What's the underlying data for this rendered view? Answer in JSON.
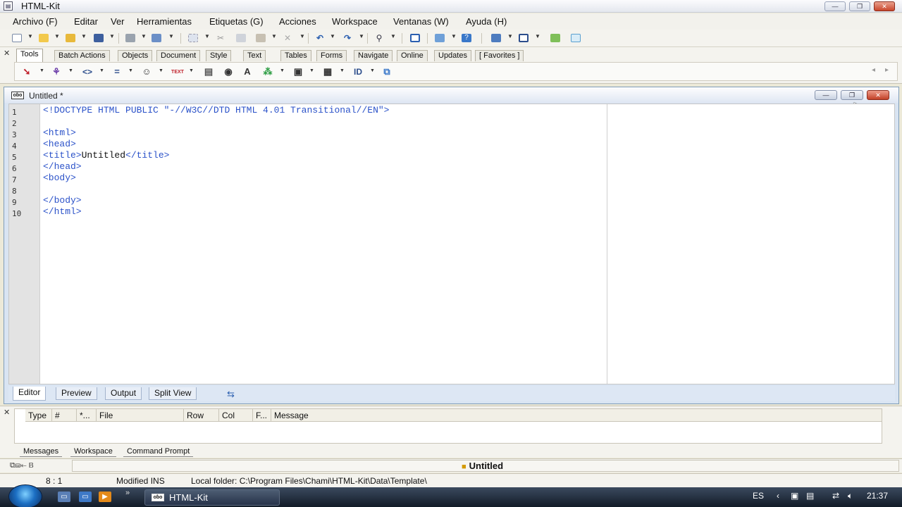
{
  "window": {
    "title": "HTML-Kit",
    "min_label": "—",
    "max_label": "❐",
    "close_label": "✕"
  },
  "menu": [
    "Archivo (F)",
    "Editar",
    "Ver",
    "Herramientas",
    "Etiquetas (G)",
    "Acciones",
    "Workspace",
    "Ventanas (W)",
    "Ayuda (H)"
  ],
  "tool_tabs": [
    "Tools",
    "Batch Actions",
    "Objects",
    "Document",
    "Style",
    "Text",
    "Tables",
    "Forms",
    "Navigate",
    "Online",
    "Updates",
    "[ Favorites ]"
  ],
  "tools_row": {
    "id_label": "ID",
    "text_label": "TEXT"
  },
  "document": {
    "title": "Untitled *",
    "icon_text": "oɓo",
    "lines": [
      {
        "n": "1",
        "code": "<!DOCTYPE HTML PUBLIC \"-//W3C//DTD HTML 4.01 Transitional//EN\">"
      },
      {
        "n": "2",
        "code": ""
      },
      {
        "n": "3",
        "code": "<html>"
      },
      {
        "n": "4",
        "code": "<head>"
      },
      {
        "n": "5",
        "code": "<title>Untitled</title>"
      },
      {
        "n": "6",
        "code": "</head>"
      },
      {
        "n": "7",
        "code": "<body>"
      },
      {
        "n": "8",
        "code": ""
      },
      {
        "n": "9",
        "code": "</body>"
      },
      {
        "n": "10",
        "code": "</html>"
      }
    ],
    "view_tabs": [
      "Editor",
      "Preview",
      "Output",
      "Split View"
    ]
  },
  "messages": {
    "columns": [
      "Type",
      "#",
      "*...",
      "File",
      "Row",
      "Col",
      "F...",
      "Message"
    ],
    "tabs": [
      "Messages",
      "Workspace",
      "Command Prompt"
    ]
  },
  "file_bar": {
    "name": "Untitled"
  },
  "status": {
    "position": "8 : 1",
    "mode": "Modified INS",
    "folder": "Local folder: C:\\Program Files\\Chami\\HTML-Kit\\Data\\Template\\"
  },
  "taskbar": {
    "task_label": "HTML-Kit",
    "lang": "ES",
    "clock": "21:37"
  },
  "colors": {
    "code_tag": "#2b52c9",
    "editor_bg": "#ffffff",
    "gutter_bg": "#e3e3e3"
  }
}
